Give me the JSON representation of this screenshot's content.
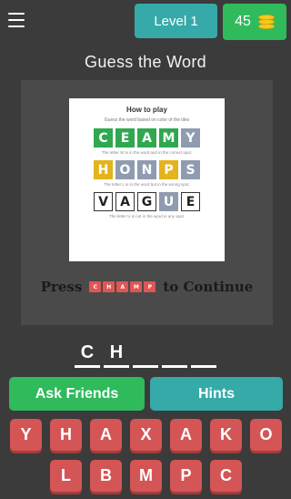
{
  "header": {
    "level_label": "Level 1",
    "coins": "45",
    "colors": {
      "level_bg": "#36aaa8",
      "coins_bg": "#2fba5b"
    }
  },
  "title": "Guess the Word",
  "how_to_play": {
    "title": "How to play",
    "subtitle": "Guess the word based on color of the tiles",
    "examples": [
      {
        "tiles": [
          {
            "letter": "C",
            "color": "green"
          },
          {
            "letter": "E",
            "color": "green"
          },
          {
            "letter": "A",
            "color": "green"
          },
          {
            "letter": "M",
            "color": "green"
          },
          {
            "letter": "Y",
            "color": "gray"
          }
        ],
        "note": "The letter W is in the word and in the correct spot."
      },
      {
        "tiles": [
          {
            "letter": "H",
            "color": "yellow"
          },
          {
            "letter": "O",
            "color": "gray"
          },
          {
            "letter": "N",
            "color": "gray"
          },
          {
            "letter": "P",
            "color": "yellow"
          },
          {
            "letter": "S",
            "color": "gray"
          }
        ],
        "note": "The letter L is in the word but in the wrong spot."
      },
      {
        "tiles": [
          {
            "letter": "V",
            "color": "white"
          },
          {
            "letter": "A",
            "color": "white"
          },
          {
            "letter": "G",
            "color": "white"
          },
          {
            "letter": "U",
            "color": "gray"
          },
          {
            "letter": "E",
            "color": "white"
          }
        ],
        "note": "The letter U is not in the word in any spot."
      }
    ],
    "press_text": "Press",
    "press_word": [
      "C",
      "H",
      "A",
      "M",
      "P"
    ],
    "continue_text": "to Continue"
  },
  "answer_slots": [
    "C",
    "H",
    "",
    "",
    ""
  ],
  "buttons": {
    "ask_friends": "Ask Friends",
    "hints": "Hints"
  },
  "keyboard": {
    "row1": [
      "Y",
      "H",
      "A",
      "X",
      "A",
      "K",
      "O"
    ],
    "row2": [
      "L",
      "B",
      "M",
      "P",
      "C"
    ]
  }
}
